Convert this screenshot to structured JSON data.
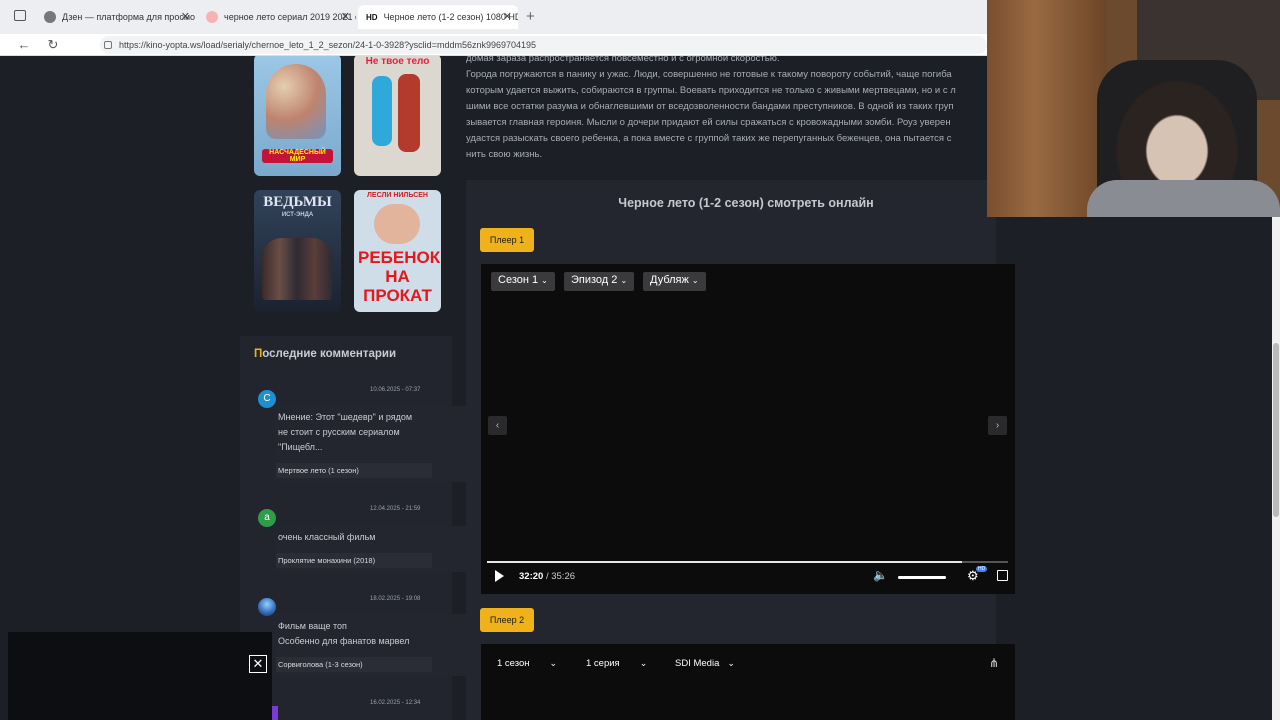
{
  "browser": {
    "tabs": [
      {
        "label": "Дзен — платформа для просмо",
        "fav_color": "#777777"
      },
      {
        "label": "черное лето сериал 2019 2021 с",
        "fav_color": "#ff7a7a"
      },
      {
        "label": "Черное лето (1-2 сезон) 1080 HD",
        "fav_badge": "HD",
        "fav_color": "#ffffff"
      }
    ],
    "new_tab": "+",
    "url": "https://kino-yopta.ws/load/serialy/chernoe_leto_1_2_sezon/24-1-0-3928?ysclid=mddm56znk9969704195"
  },
  "description_lines": [
    "домая зараза распространяется повсеместно и с огромной скоростью.",
    "Города погружаются в панику и ужас. Люди, совершенно не готовые к такому повороту событий, чаще погиба",
    "которым удается выжить, собираются в группы. Воевать приходится не только с живыми мертвецами, но и с л",
    "шими все остатки разума и обнаглевшими от вседозволенности бандами преступников. В одной из таких груп",
    "зывается главная героиня. Мысли о дочери придают ей силы сражаться с кровожадными зомби. Роуз уверен",
    "удастся разыскать своего ребенка, а пока вместе с группой таких же перепуганных беженцев, она пытается с",
    "нить свою жизнь."
  ],
  "posters": [
    {
      "label": "НАСЧАДЕСНЫЙ МИР",
      "bg": "#8fb7d6"
    },
    {
      "label": "Не твое тело",
      "bg": "#d8d3c8"
    },
    {
      "label": "ВЕДЬМЫ",
      "sub": "ИСТ-ЭНДА",
      "bg": "#2b3443"
    },
    {
      "label": "РЕБЕНОК НА ПРОКАТ",
      "top": "ЛЕСЛИ НИЛЬСЕН",
      "bg": "#c7d6e4"
    }
  ],
  "comments_heading_first": "П",
  "comments_heading_rest": "оследние комментарии",
  "comments": [
    {
      "avatar": "С",
      "avatar_color": "#1e8fd1",
      "date": "10.06.2025 - 07:37",
      "text": [
        "Мнение: Этот \"шедевр\" и рядом",
        "не стоит с русским сериалом",
        "\"Пищебл..."
      ],
      "tag": "Мертвое лето (1 сезон)"
    },
    {
      "avatar": "а",
      "avatar_color": "#2f9c4a",
      "date": "12.04.2025 - 21:59",
      "text": [
        "очень классный фильм"
      ],
      "tag": "Проклятие монахини (2018)"
    },
    {
      "avatar": "",
      "avatar_color": "#4a7fc4",
      "date": "18.02.2025 - 19:08",
      "text": [
        "Фильм ваще топ",
        "Особенно для фанатов марвел"
      ],
      "tag": "Сорвиголова (1-3 сезон)"
    },
    {
      "avatar": "",
      "avatar_color": "#7a3ad6",
      "date": "16.02.2025 - 12:34",
      "text": [],
      "tag": ""
    }
  ],
  "main": {
    "title": "Черное лето (1-2 сезон) смотреть онлайн",
    "player1_button": "Плеер 1",
    "player2_button": "Плеер 2",
    "season_dd": "Сезон 1",
    "episode_dd": "Эпизод 2",
    "dub_dd": "Дубляж",
    "time_current": "32:20",
    "time_total": "/ 35:26",
    "progress": 0.912,
    "volume": 1.0,
    "quality_badge": "HD",
    "p2_season": "1 сезон",
    "p2_episode": "1 серия",
    "p2_studio": "SDI Media"
  }
}
